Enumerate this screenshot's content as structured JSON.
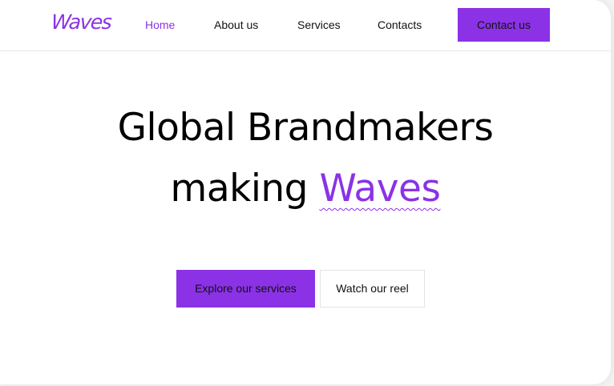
{
  "brand": {
    "logo_text": "Waves",
    "accent_color": "#8b32e6"
  },
  "nav": {
    "items": [
      {
        "label": "Home",
        "active": true
      },
      {
        "label": "About us",
        "active": false
      },
      {
        "label": "Services",
        "active": false
      },
      {
        "label": "Contacts",
        "active": false
      }
    ],
    "cta_label": "Contact us"
  },
  "hero": {
    "line1": "Global Brandmakers",
    "line2_prefix": "making ",
    "line2_accent": "Waves"
  },
  "actions": {
    "primary_label": "Explore our services",
    "secondary_label": "Watch our reel"
  }
}
